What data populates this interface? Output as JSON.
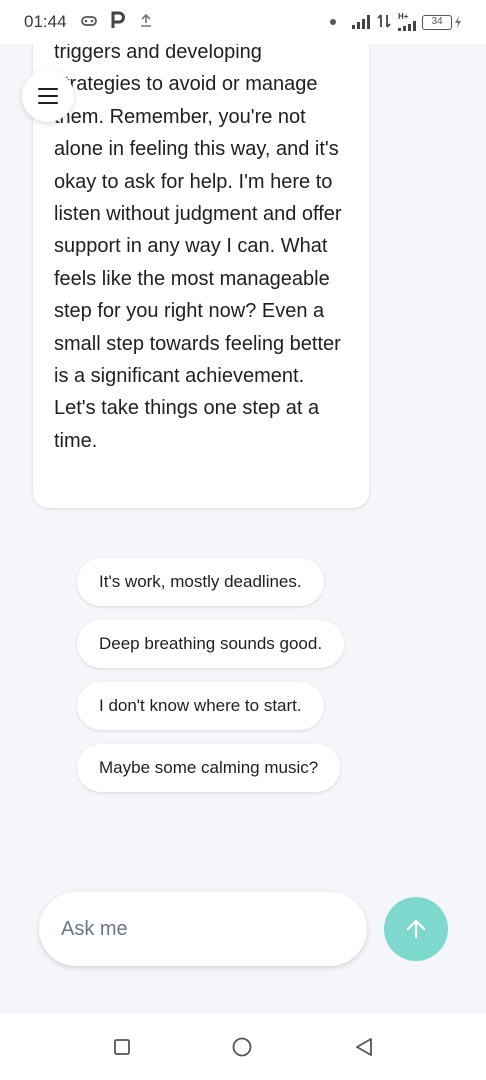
{
  "status_bar": {
    "time": "01:44",
    "left_icons": [
      "game-controller-icon",
      "parking-icon",
      "upload-icon"
    ],
    "network_label": "H+",
    "battery_level": "34"
  },
  "chat": {
    "menu_icon": "hamburger-menu-icon",
    "bot_message": "triggers and developing strategies to avoid or manage them. Remember, you're not alone in feeling this way, and it's okay to ask for help. I'm here to listen without judgment and offer support in any way I can. What feels like the most manageable step for you right now? Even a small step towards feeling better is a significant achievement. Let's take things one step at a time.",
    "suggestions": [
      {
        "label": "It's work, mostly deadlines."
      },
      {
        "label": "Deep breathing sounds good."
      },
      {
        "label": "I don't know where to start."
      },
      {
        "label": "Maybe some calming music?"
      }
    ]
  },
  "composer": {
    "placeholder": "Ask me",
    "value": "",
    "send_icon": "arrow-up-icon",
    "accent_color": "#7fd8cd"
  },
  "nav_bar": {
    "recents_icon": "square-icon",
    "home_icon": "circle-icon",
    "back_icon": "triangle-back-icon"
  }
}
